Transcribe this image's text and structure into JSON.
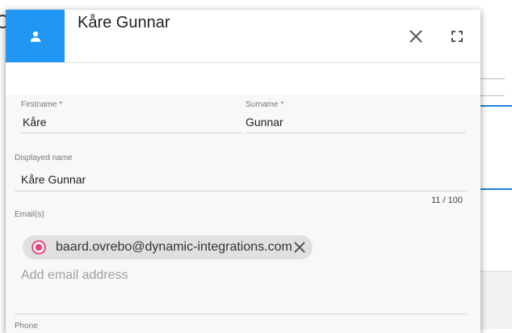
{
  "background": {
    "letter": "C"
  },
  "dialog": {
    "title": "Kåre Gunnar",
    "icons": {
      "avatar": "person-icon",
      "close": "close-icon",
      "fullscreen": "fullscreen-icon"
    }
  },
  "form": {
    "firstname": {
      "label": "Firstname *",
      "value": "Kåre"
    },
    "surname": {
      "label": "Surname *",
      "value": "Gunnar"
    },
    "displayed_name": {
      "label": "Displayed name",
      "value": "Kåre Gunnar",
      "counter": "11 / 100"
    },
    "emails": {
      "label": "Email(s)",
      "chips": [
        {
          "text": "baard.ovrebo@dynamic-integrations.com"
        }
      ],
      "placeholder": "Add email address"
    },
    "phone": {
      "label": "Phone"
    }
  },
  "colors": {
    "accent": "#2196f3",
    "chip_icon": "#e8457a",
    "chip_bg": "#e0e0e0"
  }
}
